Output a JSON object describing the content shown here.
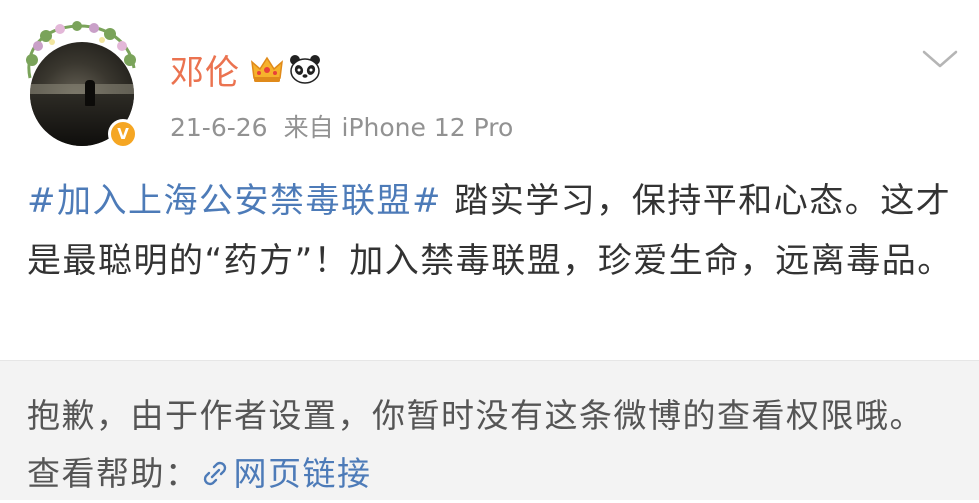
{
  "author": {
    "name": "邓伦",
    "verified": true,
    "badges": [
      "crown-icon",
      "panda-icon"
    ]
  },
  "post": {
    "date": "21-6-26",
    "source": "来自 iPhone 12 Pro",
    "hashtag": "#加入上海公安禁毒联盟#",
    "body": " 踏实学习，保持平和心态。这才是最聪明的“药方”！加入禁毒联盟，珍爱生命，远离毒品。"
  },
  "notice": {
    "text": "抱歉，由于作者设置，你暂时没有这条微博的查看权限哦。查看帮助：",
    "link_label": "网页链接"
  },
  "colors": {
    "username": "#eb7350",
    "link": "#4d7bb8",
    "meta": "#929292",
    "notice_bg": "#f3f3f3",
    "verified_badge": "#f5a623"
  },
  "icons": {
    "menu": "chevron-down-icon",
    "link": "link-icon",
    "verified": "verified-badge-icon"
  }
}
